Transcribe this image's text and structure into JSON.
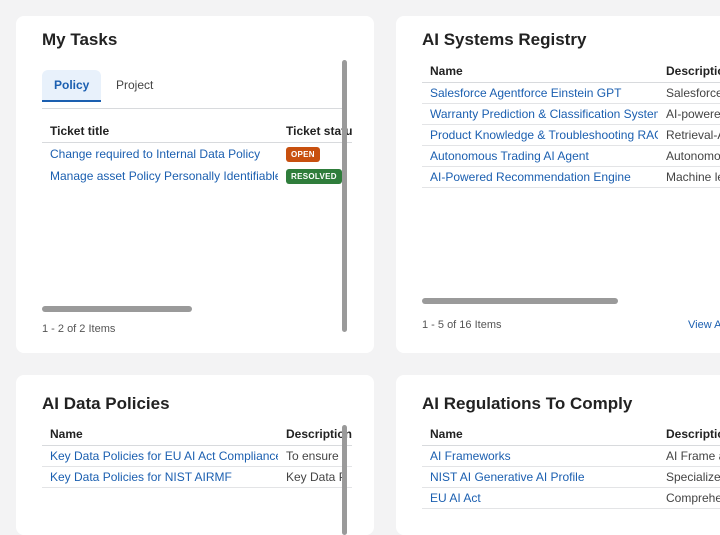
{
  "my_tasks": {
    "title": "My Tasks",
    "tabs": [
      "Policy",
      "Project"
    ],
    "columns": [
      "Ticket title",
      "Ticket status"
    ],
    "rows": [
      {
        "title": "Change required to Internal Data Policy",
        "status": "OPEN"
      },
      {
        "title": "Manage asset Policy Personally Identifiable Information",
        "status": "RESOLVED"
      }
    ],
    "footer": "1 - 2 of 2 Items"
  },
  "registry": {
    "title": "AI Systems Registry",
    "columns": [
      "Name",
      "Description"
    ],
    "rows": [
      {
        "name": "Salesforce Agentforce Einstein GPT",
        "desc": "Salesforce"
      },
      {
        "name": "Warranty Prediction & Classification System",
        "desc": "AI-powered"
      },
      {
        "name": "Product Knowledge & Troubleshooting RAG",
        "desc": "Retrieval-A"
      },
      {
        "name": "Autonomous Trading AI Agent",
        "desc": "Autonomo"
      },
      {
        "name": "AI-Powered Recommendation Engine",
        "desc": "Machine le"
      }
    ],
    "footer": "1 - 5 of 16 Items",
    "view_all": "View A"
  },
  "policies": {
    "title": "AI Data Policies",
    "columns": [
      "Name",
      "Description"
    ],
    "rows": [
      {
        "name": "Key Data Policies for EU AI Act Compliance",
        "desc": "To ensure"
      },
      {
        "name": "Key Data Policies for NIST AIRMF",
        "desc": "Key Data P"
      }
    ]
  },
  "regulations": {
    "title": "AI Regulations To Comply",
    "columns": [
      "Name",
      "Description"
    ],
    "rows": [
      {
        "name": "AI Frameworks",
        "desc": "AI Frame a"
      },
      {
        "name": "NIST AI Generative AI Profile",
        "desc": "Specialize"
      },
      {
        "name": "EU AI Act",
        "desc": "Comprehe"
      }
    ]
  }
}
